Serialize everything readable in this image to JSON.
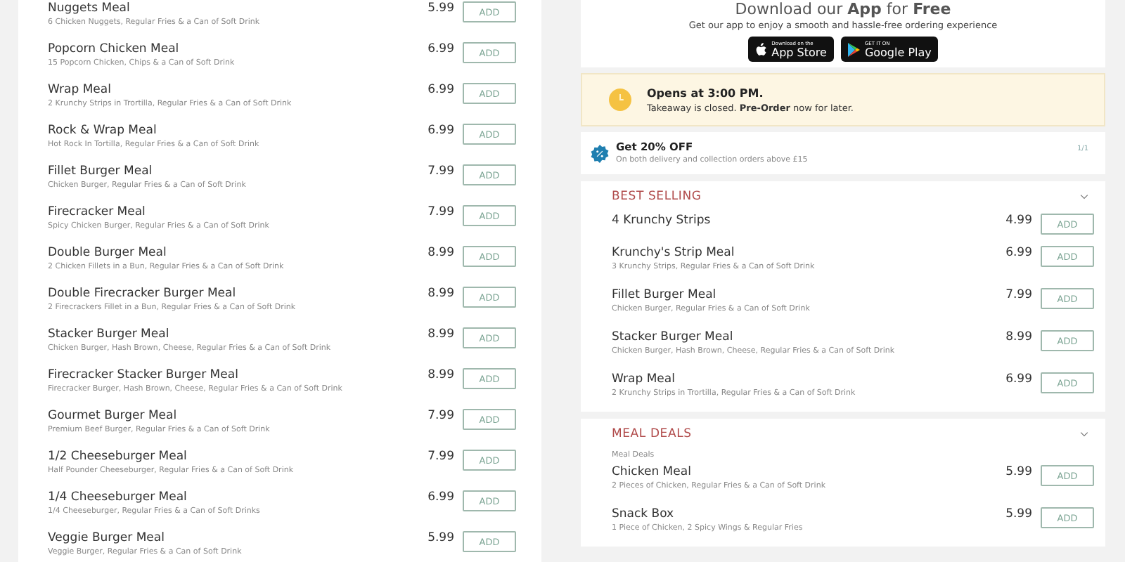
{
  "left_menu": {
    "items": [
      {
        "name": "Nuggets Meal",
        "description": "6 Chicken Nuggets, Regular Fries & a Can of Soft Drink",
        "price": "5.99",
        "button": "ADD"
      },
      {
        "name": "Popcorn Chicken Meal",
        "description": "15 Popcorn Chicken, Chips & a Can of Soft Drink",
        "price": "6.99",
        "button": "ADD"
      },
      {
        "name": "Wrap Meal",
        "description": "2 Krunchy Strips in Trortilla, Regular Fries & a Can of Soft Drink",
        "price": "6.99",
        "button": "ADD"
      },
      {
        "name": "Rock & Wrap Meal",
        "description": "Hot Rock In Tortilla, Regular Fries & a Can of Soft Drink",
        "price": "6.99",
        "button": "ADD"
      },
      {
        "name": "Fillet Burger Meal",
        "description": "Chicken Burger, Regular Fries & a Can of Soft Drink",
        "price": "7.99",
        "button": "ADD"
      },
      {
        "name": "Firecracker Meal",
        "description": "Spicy Chicken Burger, Regular Fries & a Can of Soft Drink",
        "price": "7.99",
        "button": "ADD"
      },
      {
        "name": "Double Burger Meal",
        "description": "2 Chicken Fillets in a Bun, Regular Fries & a Can of Soft Drink",
        "price": "8.99",
        "button": "ADD"
      },
      {
        "name": "Double Firecracker Burger Meal",
        "description": "2 Firecrackers Fillet in a Bun, Regular Fries & a Can of Soft Drink",
        "price": "8.99",
        "button": "ADD"
      },
      {
        "name": "Stacker Burger Meal",
        "description": "Chicken Burger, Hash Brown, Cheese, Regular Fries & a Can of Soft Drink",
        "price": "8.99",
        "button": "ADD"
      },
      {
        "name": "Firecracker Stacker Burger Meal",
        "description": "Firecracker Burger, Hash Brown, Cheese, Regular Fries & a Can of Soft Drink",
        "price": "8.99",
        "button": "ADD"
      },
      {
        "name": "Gourmet Burger Meal",
        "description": "Premium Beef Burger, Regular Fries & a Can of Soft Drink",
        "price": "7.99",
        "button": "ADD"
      },
      {
        "name": "1/2 Cheeseburger Meal",
        "description": "Half Pounder Cheeseburger, Regular Fries & a Can of Soft Drink",
        "price": "7.99",
        "button": "ADD"
      },
      {
        "name": "1/4 Cheeseburger Meal",
        "description": "1/4 Cheeseburger, Regular Fries & a Can of Soft Drinks",
        "price": "6.99",
        "button": "ADD"
      },
      {
        "name": "Veggie Burger Meal",
        "description": "Veggie Burger, Regular Fries & a Can of Soft Drink",
        "price": "5.99",
        "button": "ADD"
      }
    ]
  },
  "app_promo": {
    "title": "Download our **App** for **Free**",
    "subtitle": "Get our app to enjoy a smooth and hassle-free ordering experience",
    "badges": [
      {
        "kind": "apple",
        "small": "Download on the",
        "large": "App Store"
      },
      {
        "kind": "google",
        "small": "GET IT ON",
        "large": "Google Play"
      }
    ]
  },
  "status_banner": {
    "title": "Opens at 3:00 PM.",
    "message": "Takeaway is closed. **Pre-Order** now for later."
  },
  "offer": {
    "title": "Get 20% OFF",
    "description": "On both delivery and collection orders above £15",
    "counter": "1/1"
  },
  "sections": [
    {
      "title": "BEST SELLING",
      "items": [
        {
          "name": "4 Krunchy Strips",
          "price": "4.99",
          "button": "ADD"
        },
        {
          "name": "Krunchy's Strip Meal",
          "description": "3 Krunchy Strips, Regular Fries & a Can of Soft Drink",
          "price": "6.99",
          "button": "ADD"
        },
        {
          "name": "Fillet Burger Meal",
          "description": "Chicken Burger, Regular Fries & a Can of Soft Drink",
          "price": "7.99",
          "button": "ADD"
        },
        {
          "name": "Stacker Burger Meal",
          "description": "Chicken Burger, Hash Brown, Cheese, Regular Fries & a Can of Soft Drink",
          "price": "8.99",
          "button": "ADD"
        },
        {
          "name": "Wrap Meal",
          "description": "2 Krunchy Strips in Trortilla, Regular Fries & a Can of Soft Drink",
          "price": "6.99",
          "button": "ADD"
        }
      ]
    },
    {
      "title": "MEAL DEALS",
      "subtitle": "Meal Deals",
      "items": [
        {
          "name": "Chicken Meal",
          "description": "2 Pieces of Chicken, Regular Fries & a Can of Soft Drink",
          "price": "5.99",
          "button": "ADD"
        },
        {
          "name": "Snack Box",
          "description": "1 Piece of Chicken, 2 Spicy Wings & Regular Fries",
          "price": "5.99",
          "button": "ADD"
        }
      ]
    }
  ]
}
